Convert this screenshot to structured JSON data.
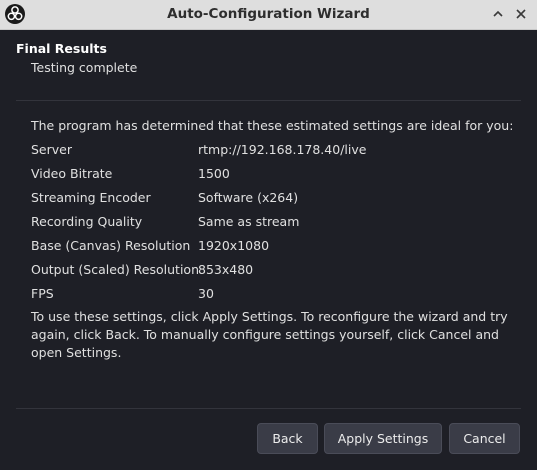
{
  "window": {
    "title": "Auto-Configuration Wizard",
    "maximize_glyph": "⌃",
    "close_glyph": "✕"
  },
  "header": {
    "title": "Final Results",
    "subtitle": "Testing complete"
  },
  "results": {
    "intro": "The program has determined that these estimated settings are ideal for you:",
    "rows": [
      {
        "label": "Server",
        "value": "rtmp://192.168.178.40/live"
      },
      {
        "label": "Video Bitrate",
        "value": "1500"
      },
      {
        "label": "Streaming Encoder",
        "value": "Software (x264)"
      },
      {
        "label": "Recording Quality",
        "value": "Same as stream"
      },
      {
        "label": "Base (Canvas) Resolution",
        "value": "1920x1080"
      },
      {
        "label": "Output (Scaled) Resolution",
        "value": "853x480"
      },
      {
        "label": "FPS",
        "value": "30"
      }
    ],
    "notice": "To use these settings, click Apply Settings. To reconfigure the wizard and try again, click Back. To manually configure settings yourself, click Cancel and open Settings."
  },
  "buttons": {
    "back": "Back",
    "apply": "Apply Settings",
    "cancel": "Cancel"
  },
  "icons": {
    "app_logo": "obs-logo-icon",
    "maximize": "chevron-up-icon",
    "close": "close-icon"
  }
}
